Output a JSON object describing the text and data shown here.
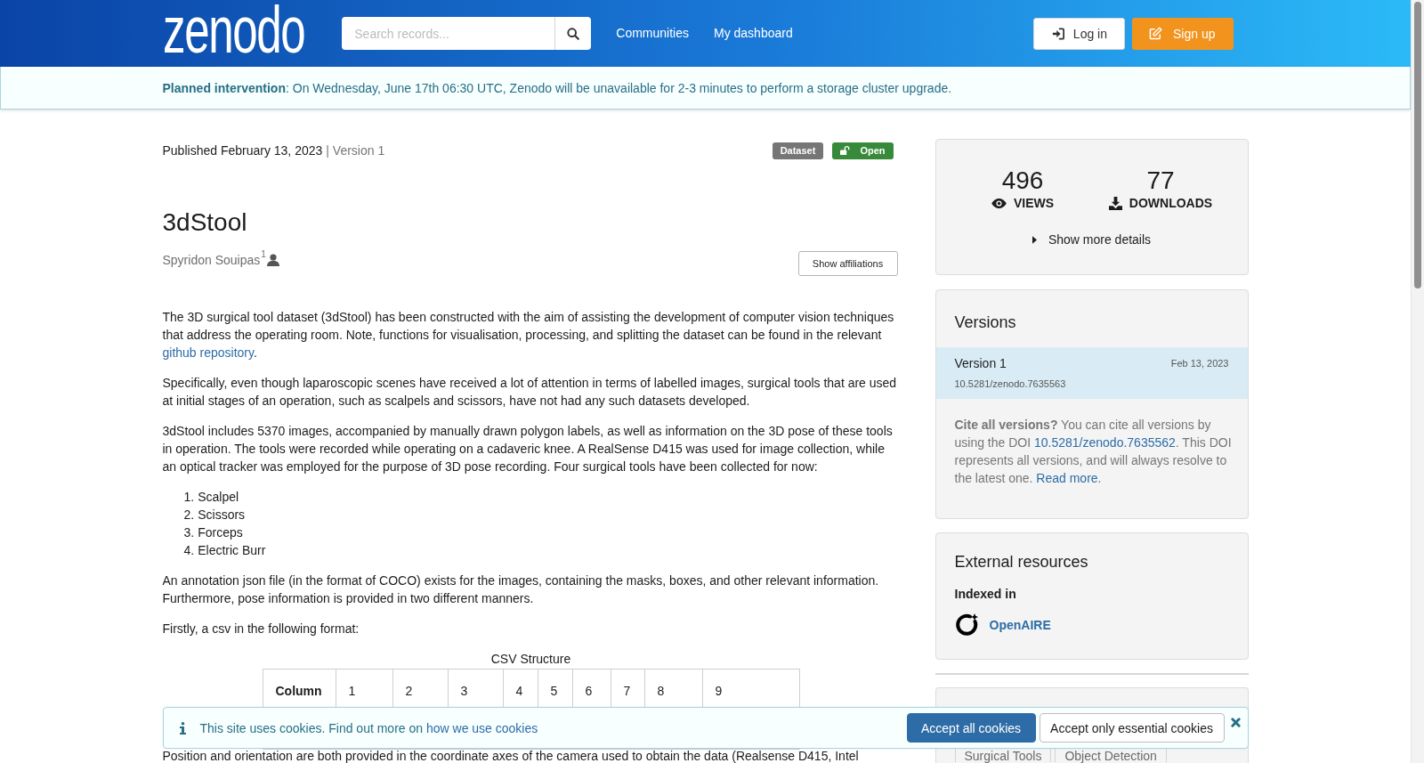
{
  "header": {
    "logo": "zenodo",
    "search": {
      "placeholder": "Search records..."
    },
    "nav": [
      {
        "label": "Communities"
      },
      {
        "label": "My dashboard"
      }
    ],
    "buttons": [
      {
        "label": "Log in",
        "kind": "login"
      },
      {
        "label": "Sign up",
        "kind": "signup"
      }
    ]
  },
  "announcement": {
    "text": "**Planned intervention**: On Wednesday, June 17th 06:30 UTC, Zenodo will be unavailable for 2-3 minutes to perform a storage cluster upgrade."
  },
  "record": {
    "published": "Published February 13, 2023",
    "version": "| Version 1",
    "badges": [
      {
        "label": "Dataset",
        "kind": "type",
        "color": "#767676"
      },
      {
        "label": "Open",
        "kind": "access",
        "color": "#388a3b"
      }
    ],
    "title": "3dStool",
    "creators": [
      {
        "name": "Spyridon Souipas",
        "affiliation": "1"
      }
    ],
    "affiliations_button": "Show affiliations",
    "description": [
      {
        "kind": "paragraph",
        "segments": [
          {
            "text": "The 3D surgical tool dataset (3dStool) has been constructed with the aim of assisting the development of computer vision techniques that address the operating room. Note, functions for visualisation, processing, and splitting the dataset can be found in the relevant "
          },
          {
            "text": "github repository",
            "kind": "link"
          },
          {
            "text": "."
          }
        ]
      },
      {
        "kind": "paragraph",
        "segments": [
          {
            "text": "Specifically, even though laparoscopic scenes have received a lot of attention in terms of labelled images, surgical tools that are used at initial stages of an operation, such as scalpels and scissors, have not had any such datasets developed."
          }
        ]
      },
      {
        "kind": "paragraph",
        "segments": [
          {
            "text": "3dStool includes 5370 images, accompanied by manually drawn polygon labels, as well as information on the 3D pose of these tools in operation. The tools were recorded while operating on a cadaveric knee. A RealSense D415 was used for image collection, while an optical tracker was employed for the purpose of 3D pose recording. Four surgical tools have been collected for now:"
          }
        ]
      },
      {
        "kind": "list",
        "items": [
          {
            "number": "1.",
            "text": "Scalpel"
          },
          {
            "number": "2.",
            "text": "Scissors"
          },
          {
            "number": "3.",
            "text": "Forceps"
          },
          {
            "number": "4.",
            "text": "Electric Burr"
          }
        ]
      },
      {
        "kind": "paragraph",
        "segments": [
          {
            "text": "An annotation json file (in the format of COCO) exists for the images, containing the masks, boxes, and other relevant information. Furthermore, pose information is provided in two different manners."
          }
        ]
      },
      {
        "kind": "paragraph",
        "segments": [
          {
            "text": "Firstly, a csv in the following format:"
          }
        ]
      },
      {
        "kind": "table",
        "caption": "CSV Structure",
        "row_header": "Column",
        "cells": [
          "1",
          "2",
          "3",
          "4",
          "5",
          "6",
          "7",
          "8",
          "9"
        ]
      },
      {
        "kind": "paragraph",
        "segments": [
          {
            "text": "Position and orientation are both provided in the coordinate axes of the camera used to obtain the data (Realsense D415, Intel"
          }
        ]
      }
    ]
  },
  "sidebar": {
    "stats": [
      {
        "value": "496",
        "label": "VIEWS",
        "kind": "views"
      },
      {
        "value": "77",
        "label": "DOWNLOADS",
        "kind": "downloads"
      }
    ],
    "details_toggle": {
      "label": "Show more details",
      "expanded": false
    },
    "versions": {
      "title": "Versions",
      "items": [
        {
          "label": "Version 1",
          "date": "Feb 13, 2023",
          "doi": "10.5281/zenodo.7635563",
          "selected": true
        }
      ],
      "note": [
        {
          "text": "**Cite all versions?** You can cite all versions by using the DOI "
        },
        {
          "text": "10.5281/zenodo.7635562",
          "kind": "link"
        },
        {
          "text": ". This DOI represents all versions, and will always resolve to the latest one. "
        },
        {
          "text": "Read more",
          "kind": "link"
        },
        {
          "text": "."
        }
      ]
    },
    "external_resources": {
      "title": "External resources",
      "subtitle": "Indexed in",
      "items": [
        {
          "label": "OpenAIRE"
        }
      ]
    },
    "keywords": [
      "Surgical Tools",
      "Object Detection"
    ]
  },
  "cookie_banner": {
    "segments": [
      {
        "text": "This site uses cookies. Find out more on "
      },
      {
        "text": "how we use cookies",
        "kind": "link"
      }
    ],
    "buttons": [
      {
        "label": "Accept all cookies",
        "kind": "primary"
      },
      {
        "label": "Accept only essential cookies",
        "kind": "secondary"
      }
    ]
  }
}
